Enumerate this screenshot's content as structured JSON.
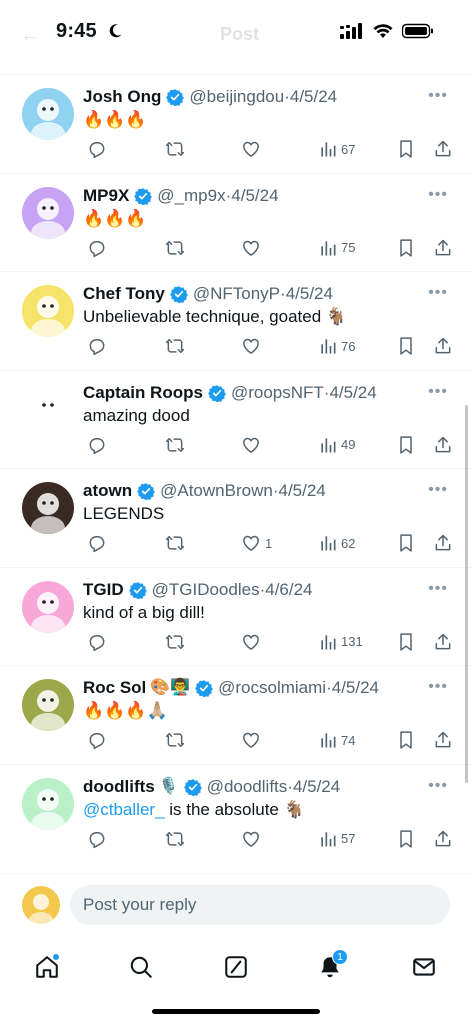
{
  "status_bar": {
    "time": "9:45"
  },
  "header": {
    "back_label": "←",
    "title": "Post"
  },
  "tweets": [
    {
      "name": "Josh Ong",
      "handle": "@beijingdou",
      "dot": "·",
      "date": "4/5/24",
      "name_emoji": "",
      "text": "🔥🔥🔥",
      "mention": "",
      "text_after": "",
      "replies": "",
      "retweets": "",
      "likes": "",
      "views": "67",
      "avatar_color": "#8fd3f0"
    },
    {
      "name": "MP9X",
      "handle": "@_mp9x",
      "dot": "·",
      "date": "4/5/24",
      "name_emoji": "",
      "text": "🔥🔥🔥",
      "mention": "",
      "text_after": "",
      "replies": "",
      "retweets": "",
      "likes": "",
      "views": "75",
      "avatar_color": "#c7a3f5"
    },
    {
      "name": "Chef Tony",
      "handle": "@NFTonyP",
      "dot": "·",
      "date": "4/5/24",
      "name_emoji": "",
      "text": "Unbelievable technique, goated 🐐",
      "mention": "",
      "text_after": "",
      "replies": "",
      "retweets": "",
      "likes": "",
      "views": "76",
      "avatar_color": "#f6e36a"
    },
    {
      "name": "Captain Roops",
      "handle": "@roopsNFT",
      "dot": "·",
      "date": "4/5/24",
      "name_emoji": "",
      "text": "amazing dood",
      "mention": "",
      "text_after": "",
      "replies": "",
      "retweets": "",
      "likes": "",
      "views": "49",
      "avatar_color": "#ffffff"
    },
    {
      "name": "atown",
      "handle": "@AtownBrown",
      "dot": "·",
      "date": "4/5/24",
      "name_emoji": "",
      "text": "LEGENDS",
      "mention": "",
      "text_after": "",
      "replies": "",
      "retweets": "",
      "likes": "1",
      "views": "62",
      "avatar_color": "#3a2a22"
    },
    {
      "name": "TGID",
      "handle": "@TGIDoodles",
      "dot": "·",
      "date": "4/6/24",
      "name_emoji": "",
      "text": "kind of a big dill!",
      "mention": "",
      "text_after": "",
      "replies": "",
      "retweets": "",
      "likes": "",
      "views": "131",
      "avatar_color": "#f7a8d8"
    },
    {
      "name": "Roc Sol",
      "handle": "@rocsolmiami",
      "dot": "·",
      "date": "4/5/24",
      "name_emoji": "🎨👨‍🏫",
      "text": "🔥🔥🔥🙏🏼",
      "mention": "",
      "text_after": "",
      "replies": "",
      "retweets": "",
      "likes": "",
      "views": "74",
      "avatar_color": "#9aa84a"
    },
    {
      "name": "doodlifts",
      "handle": "@doodlifts",
      "dot": "·",
      "date": "4/5/24",
      "name_emoji": "🎙️",
      "text": "",
      "mention": "@ctballer_",
      "text_after": " is the absolute 🐐",
      "replies": "",
      "retweets": "",
      "likes": "",
      "views": "57",
      "avatar_color": "#b8f0c8"
    }
  ],
  "reply": {
    "placeholder": "Post your reply",
    "avatar_color": "#f2c94c"
  },
  "tab_bar": {
    "notification_count": "1"
  },
  "colors": {
    "accent": "#1d9bf0",
    "secondary_text": "#536471",
    "divider": "#eff3f4"
  },
  "icons": [
    "reply-icon",
    "retweet-icon",
    "heart-icon",
    "views-icon",
    "bookmark-icon",
    "share-icon",
    "verified-badge-icon",
    "home-icon",
    "search-icon",
    "compose-icon",
    "bell-icon",
    "mail-icon"
  ]
}
